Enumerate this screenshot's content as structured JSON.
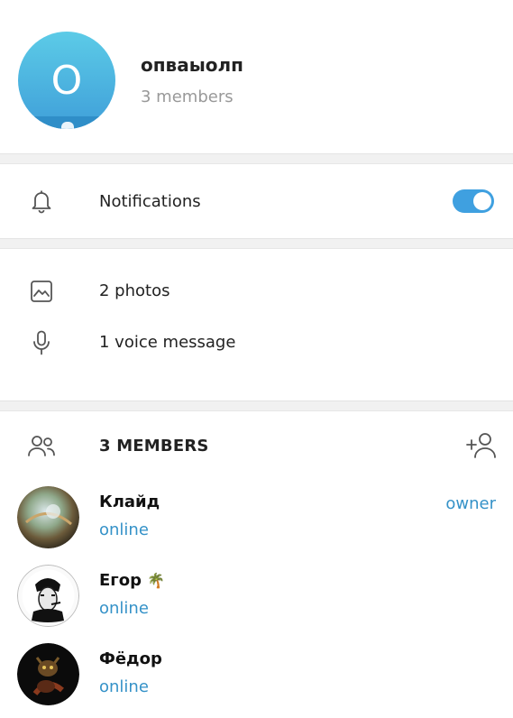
{
  "chat": {
    "avatar_letter": "O",
    "title": "опваыолп",
    "subtitle": "3 members"
  },
  "settings": {
    "notifications_label": "Notifications",
    "notifications_enabled": true
  },
  "media": {
    "photos_label": "2 photos",
    "voice_label": "1 voice message"
  },
  "members": {
    "header_label": "3 MEMBERS",
    "list": [
      {
        "name": "Клайд",
        "status": "online",
        "role": "owner"
      },
      {
        "name": "Егор",
        "status": "online",
        "role": ""
      },
      {
        "name": "Фёдор",
        "status": "online",
        "role": ""
      }
    ]
  },
  "icons": {
    "notifications": "bell-icon",
    "photos": "image-icon",
    "voice": "microphone-icon",
    "members": "users-icon",
    "add_member": "add-user-icon",
    "badge": "palm-tree-icon"
  },
  "colors": {
    "accent": "#3fa0e0",
    "link": "#3592c8",
    "muted": "#999999"
  }
}
